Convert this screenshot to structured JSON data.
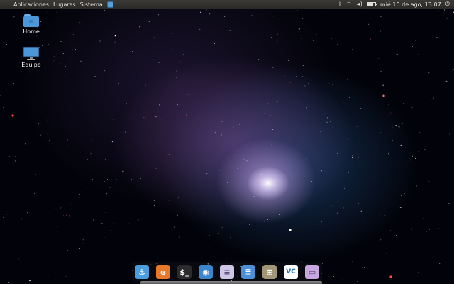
{
  "top_panel": {
    "menu": [
      "Aplicaciones",
      "Lugares",
      "Sistema"
    ],
    "clock": "mié 10 de ago, 13:07",
    "tray_icons": [
      "bluetooth-icon",
      "wifi-icon",
      "volume-icon",
      "battery-icon",
      "power-icon"
    ],
    "battery_level": 0.7
  },
  "desktop": {
    "icons": [
      {
        "label": "Home",
        "icon": "folder-icon"
      },
      {
        "label": "Equipo",
        "icon": "computer-icon"
      }
    ]
  },
  "dock": {
    "items": [
      {
        "name": "anchor-app-icon",
        "color": "#4a9ee0",
        "glyph": "⚓"
      },
      {
        "name": "firefox-icon",
        "color": "#e8782a",
        "glyph": "ɞ"
      },
      {
        "name": "terminal-icon",
        "color": "#2b2b2b",
        "glyph": "$_"
      },
      {
        "name": "screenshot-icon",
        "color": "#3c86d0",
        "glyph": "◉"
      },
      {
        "name": "text-editor-icon",
        "color": "#cfc6e8",
        "glyph": "≡"
      },
      {
        "name": "document-viewer-icon",
        "color": "#4a8fd8",
        "glyph": "≣"
      },
      {
        "name": "archive-icon",
        "color": "#a29678",
        "glyph": "⊞"
      },
      {
        "name": "vc-app-icon",
        "color": "#ffffff",
        "glyph": "VC"
      },
      {
        "name": "file-manager-icon",
        "color": "#c9a7e0",
        "glyph": "▭"
      }
    ]
  },
  "colors": {
    "panel": "#2f2e2b",
    "folder": "#4c97d8"
  }
}
